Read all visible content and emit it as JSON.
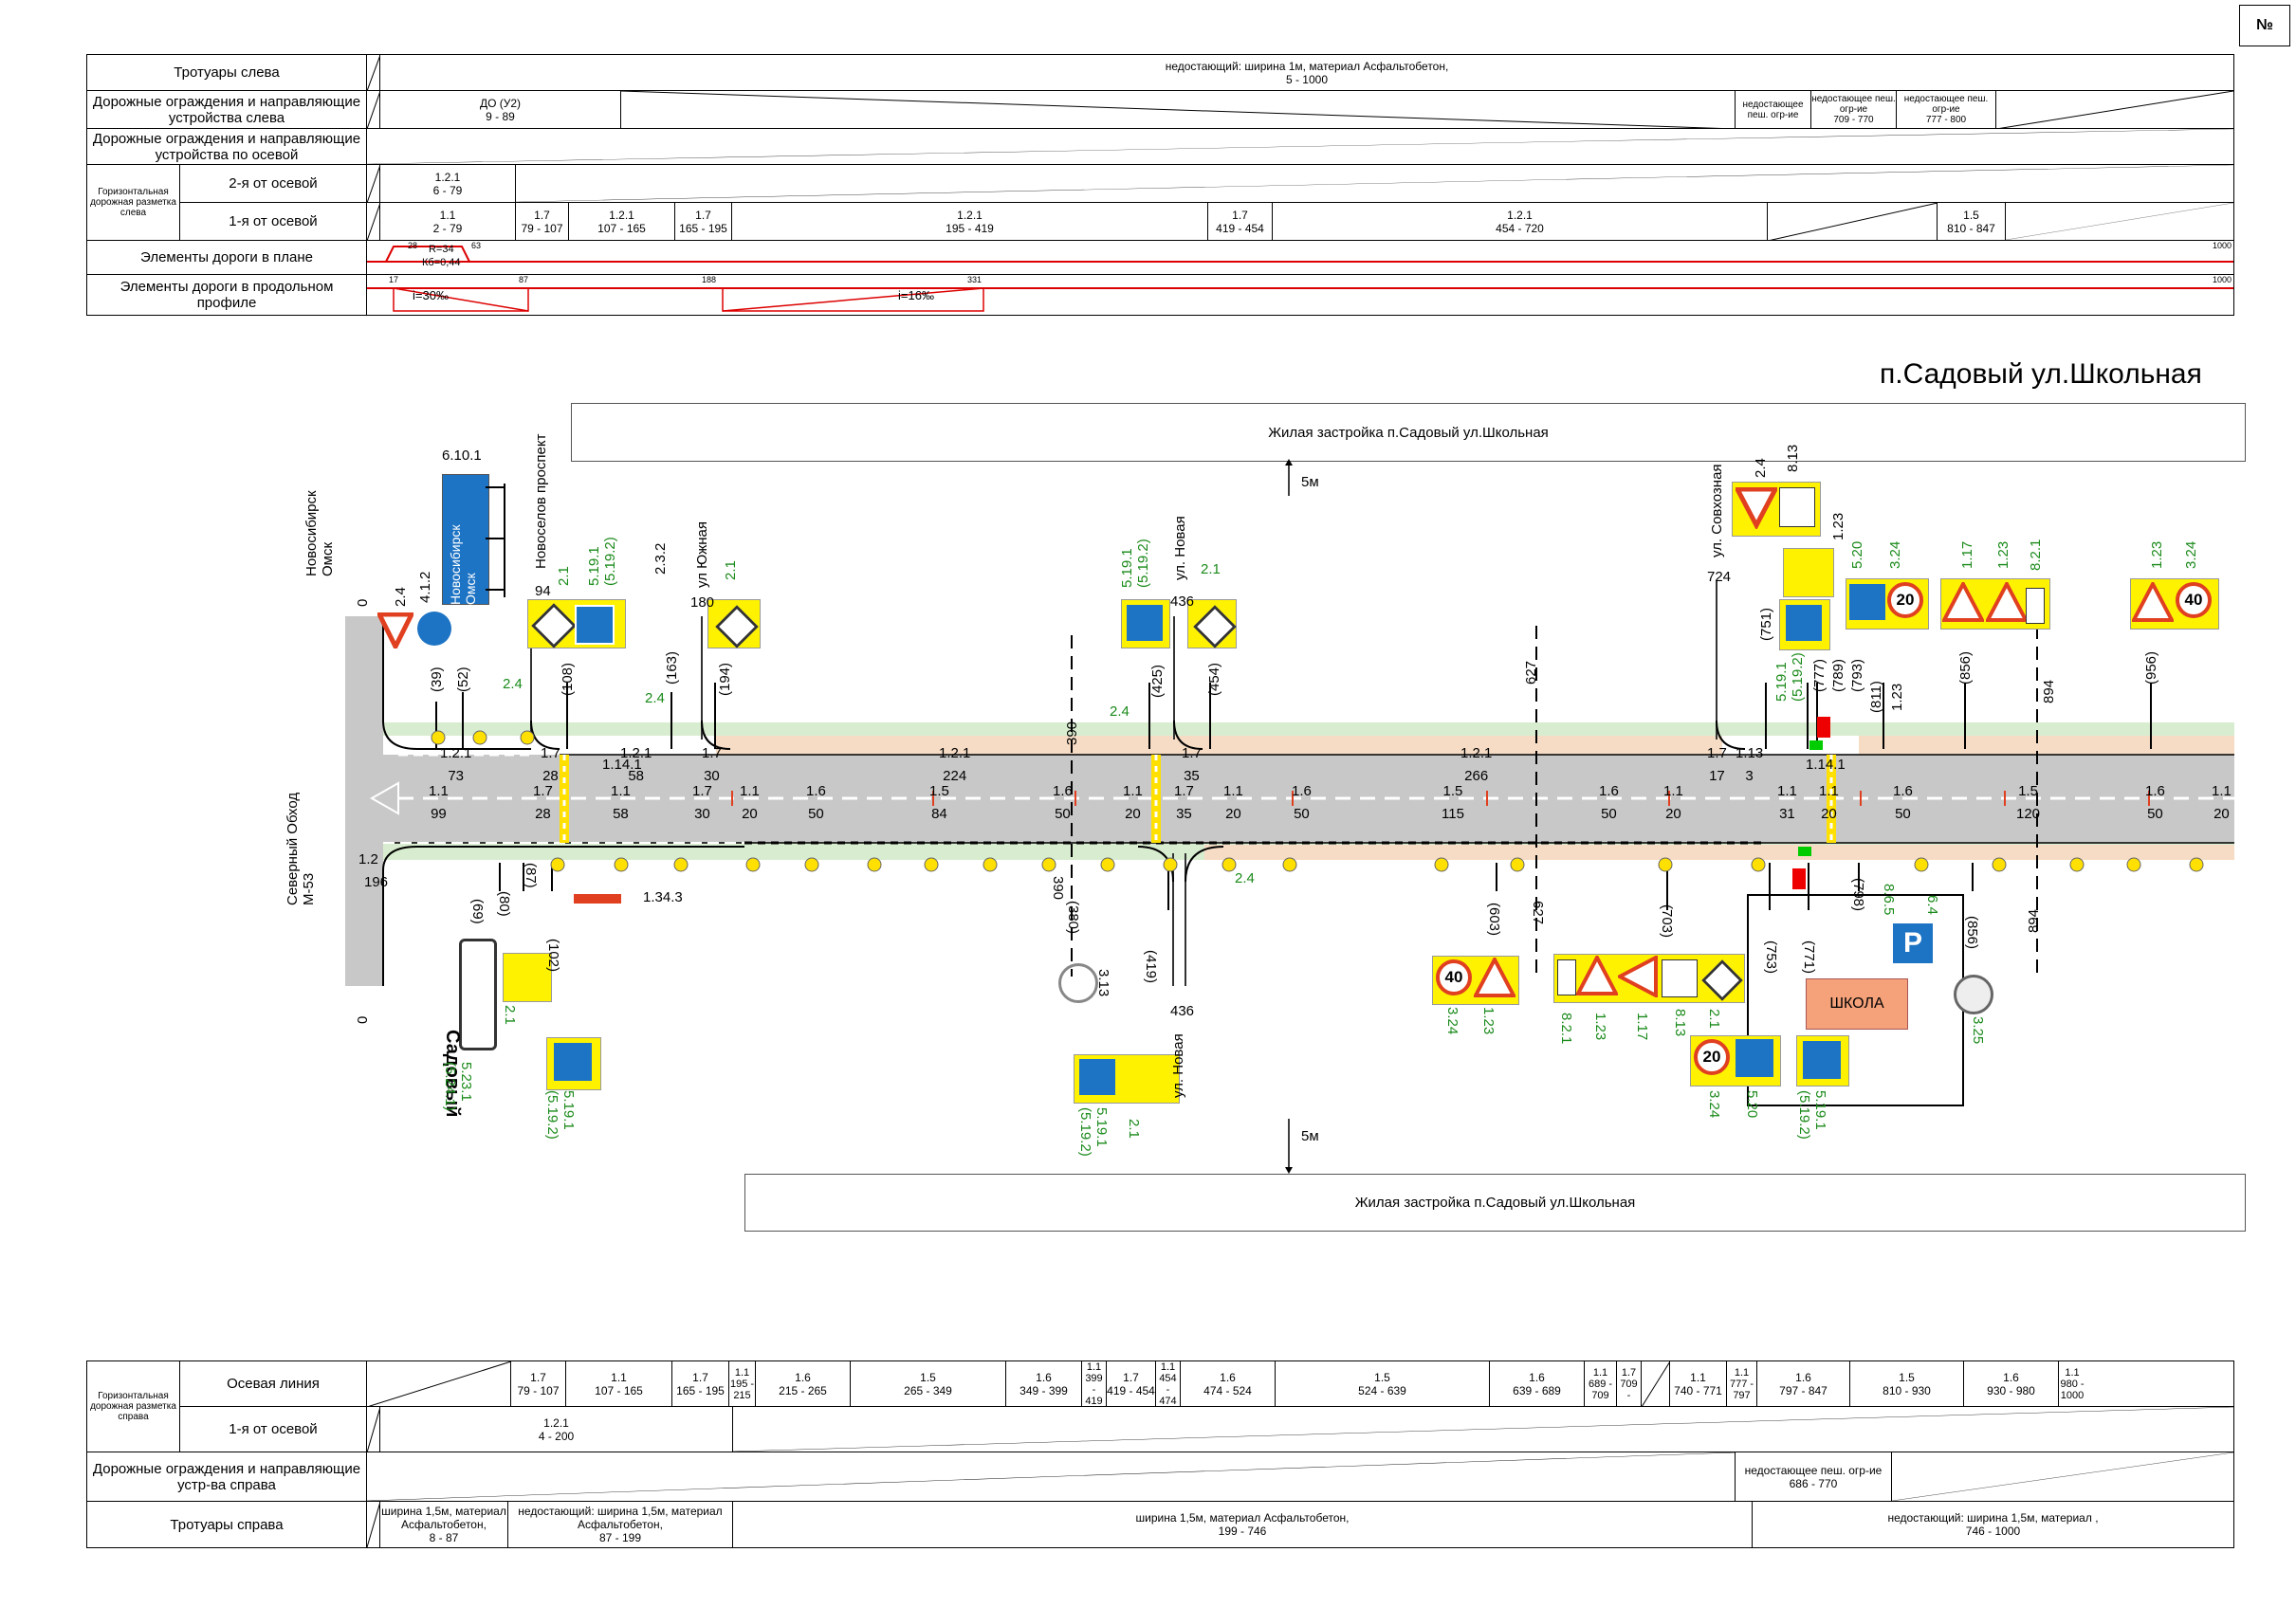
{
  "page": {
    "corner_label": "№",
    "title": "п.Садовый ул.Школьная"
  },
  "top_table": {
    "rows": [
      {
        "label": "Тротуары слева",
        "cells": [
          {
            "text": "недостающий: ширина 1м, материал Асфальтобетон,\n5 - 1000"
          }
        ]
      },
      {
        "label": "Дорожные ограждения и направляющие устройства слева",
        "cells": [
          {
            "text": "ДО (У2)\n9 - 89"
          },
          {
            "text": "недостающее пеш. огр-ие"
          },
          {
            "text": "недостающее пеш. огр-ие\n709 - 770"
          },
          {
            "text": "недостающее пеш. огр-ие\n777 - 800"
          }
        ]
      },
      {
        "label": "Дорожные ограждения и направляющие устройства по осевой",
        "cells": []
      },
      {
        "label": "2-я от осевой",
        "cells": [
          {
            "text": "1.2.1\n6 - 79"
          }
        ]
      },
      {
        "label": "1-я от осевой",
        "cells": [
          {
            "text": "1.1\n2 - 79"
          },
          {
            "text": "1.7\n79 - 107"
          },
          {
            "text": "1.2.1\n107 - 165"
          },
          {
            "text": "1.7\n165 - 195"
          },
          {
            "text": "1.2.1\n195 - 419"
          },
          {
            "text": "1.7\n419 - 454"
          },
          {
            "text": "1.2.1\n454 - 720"
          },
          {
            "text": ""
          },
          {
            "text": "1.5\n810 - 847"
          },
          {
            "text": ""
          }
        ]
      },
      {
        "label": "Элементы дороги в плане",
        "cells": [
          {
            "text": "R=34\nКб=0,44"
          }
        ]
      },
      {
        "label": "Элементы дороги в продольном профиле",
        "cells": [
          {
            "text": "i=30‰"
          },
          {
            "text": "i=16‰"
          }
        ]
      }
    ],
    "group_label": "Горизонтальная дорожная разметка слева",
    "plan_ticks": {
      "start": "28",
      "mid": "63",
      "end": "1000"
    },
    "profile_ticks": {
      "start": "17",
      "a": "87",
      "b": "188",
      "c": "331",
      "end": "1000"
    }
  },
  "bottom_table": {
    "group_label": "Горизонтальная дорожная разметка справа",
    "rows": [
      {
        "label": "Осевая линия",
        "cells": [
          "",
          "1.7\n79 - 107",
          "1.1\n107 - 165",
          "1.7\n165 - 195",
          "1.1\n195 - 215",
          "1.6\n215 - 265",
          "1.5\n265 - 349",
          "1.6\n349 - 399",
          "1.1\n399 - 419",
          "1.7\n419 - 454",
          "1.1\n454 - 474",
          "1.6\n474 - 524",
          "1.5\n524 - 639",
          "1.6\n639 - 689",
          "1.1\n689 - 709",
          "1.7\n709 -",
          "",
          "1.1\n740 - 771",
          "1.1\n777 - 797",
          "1.6\n797 - 847",
          "1.5\n810 - 930",
          "1.6\n930 - 980",
          "1.1\n980 - 1000"
        ]
      },
      {
        "label": "1-я от осевой",
        "cells": [
          "1.2.1\n4 - 200"
        ]
      },
      {
        "label": "Дорожные ограждения и направляющие устр-ва справа",
        "cells": [
          "недостающее пеш. огр-ие\n686 - 770"
        ]
      },
      {
        "label": "Тротуары справа",
        "cells": [
          "ширина 1,5м, материал Асфальтобетон,\n8 - 87",
          "недостающий: ширина 1,5м, материал Асфальтобетон,\n87 - 199",
          "ширина 1,5м, материал Асфальтобетон,\n199 - 746",
          "недостающий: ширина 1,5м, материал ,\n746 - 1000"
        ]
      }
    ]
  },
  "zones": {
    "top": "Жилая застройка п.Садовый ул.Школьная",
    "bottom": "Жилая застройка п.Садовый ул.Школьная",
    "offset_top": "5м",
    "offset_bottom": "5м",
    "school": "ШКОЛА"
  },
  "streets": {
    "novoselov": "Новоселов проспект",
    "yuzhnaya": "ул Южная",
    "novaya_top": "ул. Новая",
    "novaya_bottom": "ул. Новая",
    "sovkhoznaya": "ул. Совхозная",
    "bypass": "Северный Обход\nМ-53",
    "direction": "Новосибирск\nОмск",
    "sadovy": "Садовый"
  },
  "chainage": {
    "c94": "94",
    "c180": "180",
    "c436": "436",
    "c436b": "436",
    "c724": "724",
    "c627": "627",
    "c627b": "627",
    "c894": "894",
    "c894b": "894",
    "c0": "0",
    "c0b": "0",
    "c196": "196",
    "c390": "390",
    "c390b": "390"
  },
  "signs": {
    "s6101": "6.10.1",
    "s412": "4.1.2",
    "s24": "2.4",
    "s21": "2.1",
    "s5191": "5.19.1\n(5.19.2)",
    "s232": "2.3.2",
    "s313": "3.13",
    "s813": "8.13",
    "s123": "1.23",
    "s520": "5.20",
    "s324": "3.24",
    "s117": "1.17",
    "s821": "8.2.1",
    "s1343": "1.34.3",
    "s5231": "5.23.1\n(5.24.1)",
    "s325": "3.25",
    "s64": "6.4",
    "s865": "8.6.5",
    "speed20": "20",
    "speed40": "40"
  },
  "sign_positions": [
    "(39)",
    "(52)",
    "(108)",
    "(163)",
    "(194)",
    "(425)",
    "(454)",
    "(751)",
    "(777)",
    "(789)",
    "(793)",
    "(811)",
    "(856)",
    "(956)",
    "(69)",
    "(80)",
    "(87)",
    "(102)",
    "(380)",
    "(419)",
    "(603)",
    "(703)",
    "(753)",
    "(771)",
    "(798)",
    "(856)"
  ],
  "lane_marks_top": [
    [
      "1.2.1",
      "73"
    ],
    [
      "1.7",
      "28"
    ],
    [
      "1.2.1",
      "58"
    ],
    [
      "1.14.1",
      ""
    ],
    [
      "1.7",
      "30"
    ],
    [
      "1.2.1",
      "224"
    ],
    [
      "1.7",
      "35"
    ],
    [
      "1.2.1",
      "266"
    ],
    [
      "1.7",
      "17"
    ],
    [
      "1.13",
      "3"
    ],
    [
      "1.14.1",
      ""
    ]
  ],
  "lane_marks_mid": [
    [
      "1.1",
      "99"
    ],
    [
      "1.7",
      "28"
    ],
    [
      "1.1",
      "58"
    ],
    [
      "1.7",
      "30"
    ],
    [
      "1.1",
      "20"
    ],
    [
      "1.6",
      "50"
    ],
    [
      "1.5",
      "84"
    ],
    [
      "1.6",
      "50"
    ],
    [
      "1.1",
      "20"
    ],
    [
      "1.7",
      "35"
    ],
    [
      "1.1",
      "20"
    ],
    [
      "1.6",
      "50"
    ],
    [
      "1.5",
      "115"
    ],
    [
      "1.6",
      "50"
    ],
    [
      "1.1",
      "20"
    ],
    [
      "1.1",
      "31"
    ],
    [
      "1.1",
      "20"
    ],
    [
      "1.6",
      "50"
    ],
    [
      "1.5",
      "120"
    ],
    [
      "1.6",
      "50"
    ],
    [
      "1.1",
      "20"
    ]
  ],
  "misc": {
    "m12": "1.2"
  },
  "colors": {
    "road": "#c8c8c8",
    "verge": "#d8edd0",
    "sidewalk": "#f6dcc5",
    "sign_yellow": "#fff200",
    "sign_blue": "#1d73c4",
    "red": "#e04020",
    "school": "#f5a27a",
    "green_text": "#1a8a1a"
  }
}
